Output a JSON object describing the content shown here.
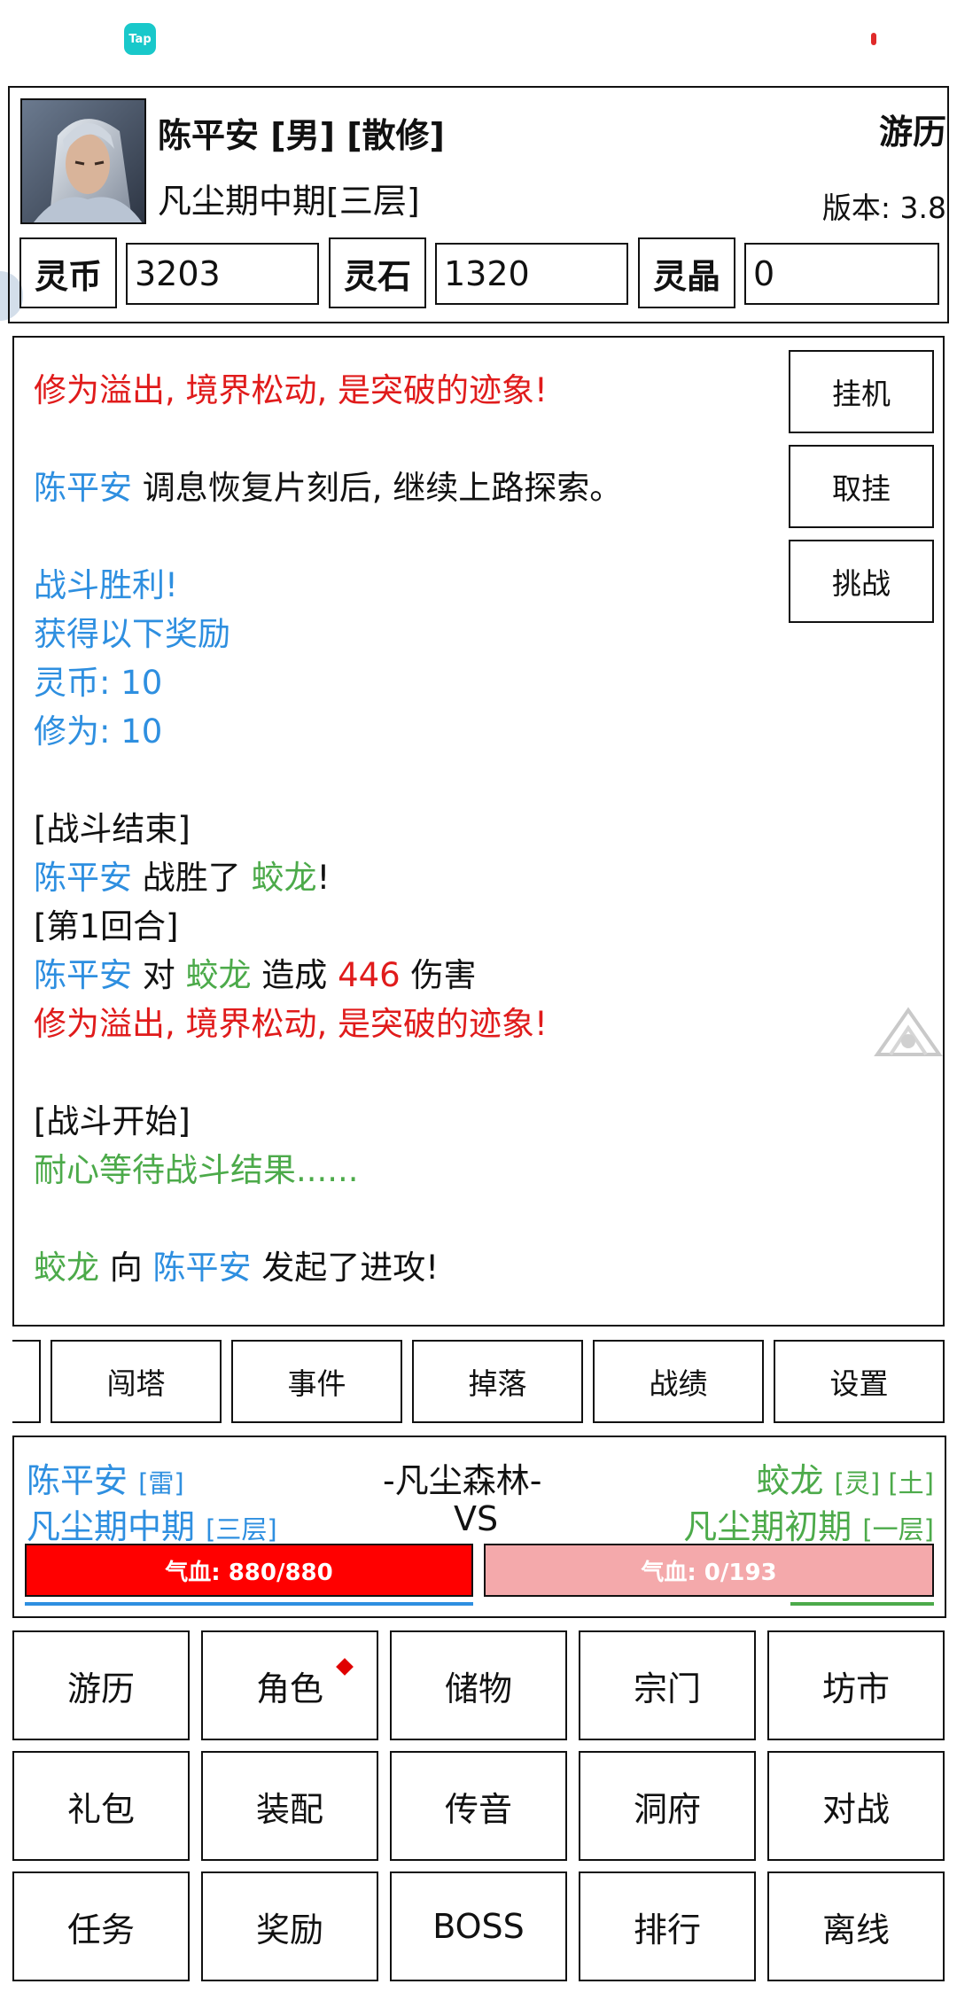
{
  "status_bar": {
    "app_icon_text": "Tap"
  },
  "header": {
    "name": "陈平安 [男] [散修]",
    "realm": "凡尘期中期[三层]",
    "location": "游历",
    "version": "版本: 3.8"
  },
  "currencies": [
    {
      "label": "灵币",
      "value": "3203"
    },
    {
      "label": "灵石",
      "value": "1320"
    },
    {
      "label": "灵晶",
      "value": "0"
    }
  ],
  "log": {
    "lines": [
      [
        {
          "text": "修为溢出, 境界松动, 是突破的迹象!",
          "color": "red"
        }
      ],
      [
        {
          "text": "陈平安",
          "color": "blue"
        },
        {
          "text": " 调息恢复片刻后, 继续上路探索。",
          "color": "dark"
        }
      ],
      [
        {
          "text": "战斗胜利!",
          "color": "blue"
        }
      ],
      [
        {
          "text": "获得以下奖励",
          "color": "blue"
        }
      ],
      [
        {
          "text": "灵币: 10",
          "color": "blue"
        }
      ],
      [
        {
          "text": "修为: 10",
          "color": "blue"
        }
      ],
      [
        {
          "text": "[战斗结束]",
          "color": "dark"
        }
      ],
      [
        {
          "text": "陈平安",
          "color": "blue"
        },
        {
          "text": " 战胜了 ",
          "color": "dark"
        },
        {
          "text": "蛟龙",
          "color": "green"
        },
        {
          "text": "!",
          "color": "dark"
        }
      ],
      [
        {
          "text": "[第1回合]",
          "color": "dark"
        }
      ],
      [
        {
          "text": "陈平安",
          "color": "blue"
        },
        {
          "text": " 对 ",
          "color": "dark"
        },
        {
          "text": "蛟龙",
          "color": "green"
        },
        {
          "text": " 造成 ",
          "color": "dark"
        },
        {
          "text": "446",
          "color": "red"
        },
        {
          "text": " 伤害",
          "color": "dark"
        }
      ],
      [
        {
          "text": "修为溢出, 境界松动, 是突破的迹象!",
          "color": "red"
        }
      ],
      [
        {
          "text": "[战斗开始]",
          "color": "dark"
        }
      ],
      [
        {
          "text": "耐心等待战斗结果......",
          "color": "green"
        }
      ],
      [
        {
          "text": "蛟龙",
          "color": "green"
        },
        {
          "text": " 向 ",
          "color": "dark"
        },
        {
          "text": "陈平安",
          "color": "blue"
        },
        {
          "text": " 发起了进攻!",
          "color": "dark"
        }
      ]
    ],
    "side_buttons": [
      "挂机",
      "取挂",
      "挑战"
    ]
  },
  "tabs": [
    "闯塔",
    "事件",
    "掉落",
    "战绩",
    "设置"
  ],
  "battle": {
    "player_name": "陈平安",
    "player_element": "[雷]",
    "player_realm": "凡尘期中期",
    "player_layer": "[三层]",
    "location": "-凡尘森林-",
    "vs": "VS",
    "enemy_name": "蛟龙",
    "enemy_tags": "[灵] [土]",
    "enemy_realm": "凡尘期初期",
    "enemy_layer": "[一层]",
    "player_hp": "气血: 880/880",
    "enemy_hp": "气血: 0/193",
    "player_hp_fraction": 1.0,
    "enemy_hp_fraction": 0.0
  },
  "menu": [
    [
      "游历",
      "角色",
      "储物",
      "宗门",
      "坊市"
    ],
    [
      "礼包",
      "装配",
      "传音",
      "洞府",
      "对战"
    ],
    [
      "任务",
      "奖励",
      "BOSS",
      "排行",
      "离线"
    ]
  ],
  "colors": {
    "blue": "#2e8fe0",
    "green": "#4caa4a",
    "red": "#e01b1b",
    "hp_full": "#ff0000",
    "hp_empty": "#f4a9ab"
  }
}
